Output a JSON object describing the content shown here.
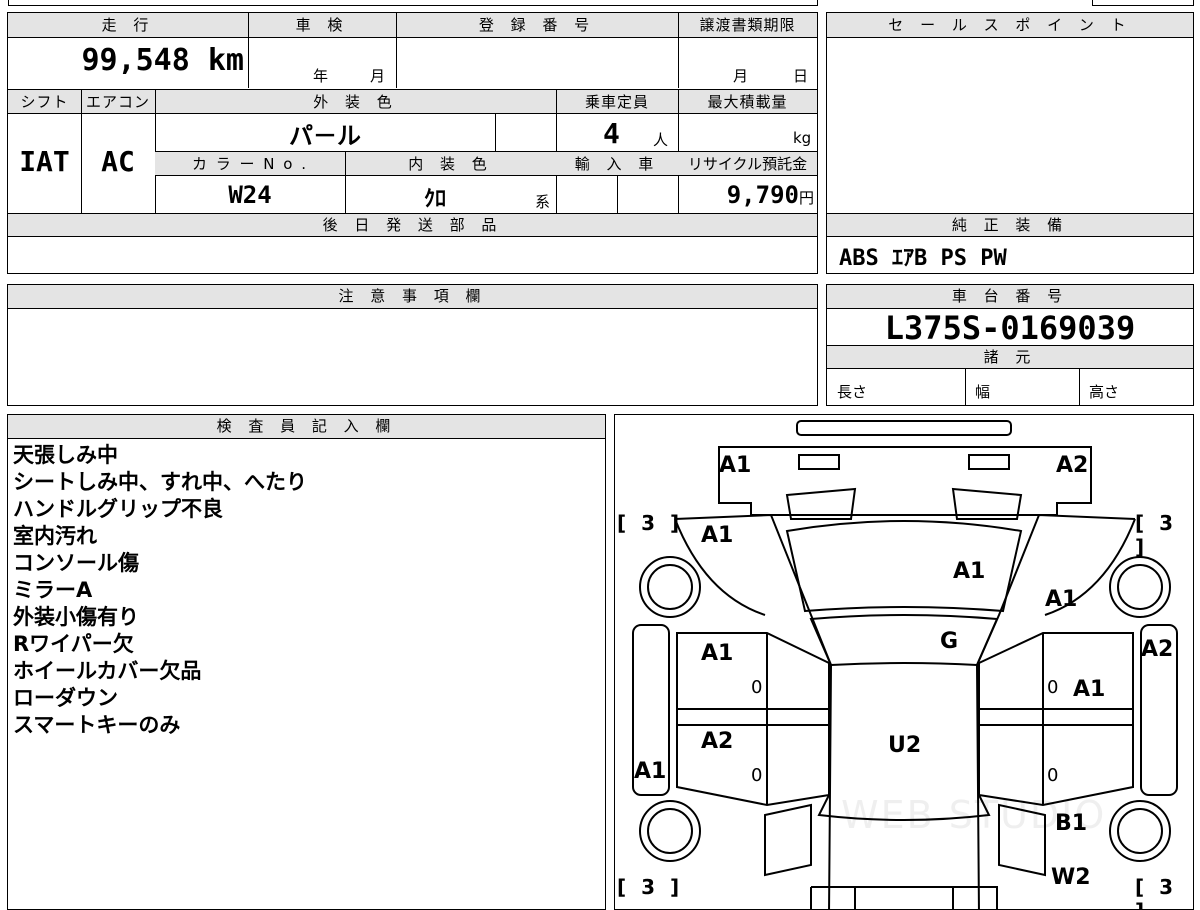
{
  "top": {
    "mileage_label": "走 行",
    "mileage_value": "99,548",
    "mileage_unit": "km",
    "inspection_label": "車 検",
    "inspection_year": "年",
    "inspection_month": "月",
    "registration_label": "登 録 番 号",
    "transfer_label": "譲渡書類期限",
    "transfer_month": "月",
    "transfer_day": "日"
  },
  "specs": {
    "shift_label": "シフト",
    "shift_value": "IAT",
    "ac_label": "エアコン",
    "ac_value": "AC",
    "exterior_label": "外 装 色",
    "exterior_value": "パ－ル",
    "capacity_label": "乗車定員",
    "capacity_value": "4",
    "capacity_unit": "人",
    "max_load_label": "最大積載量",
    "max_load_unit": "kg",
    "color_no_label": "カ ラ ー N o .",
    "color_no_value": "W24",
    "interior_label": "内 装 色",
    "interior_value": "ｸﾛ",
    "interior_suffix": "系",
    "import_label": "輸 入 車",
    "recycle_label": "リサイクル預託金",
    "recycle_value": "9,790",
    "recycle_unit": "円"
  },
  "sales_point": {
    "label": "セ ー ル ス ポ イ ン ト"
  },
  "later_parts": {
    "label": "後 日 発 送 部 品"
  },
  "equipment": {
    "label": "純 正 装 備",
    "value": "ABS ｴｱB PS PW"
  },
  "notes": {
    "label": "注 意 事 項 欄"
  },
  "chassis": {
    "label": "車 台 番 号",
    "value": "L375S-0169039"
  },
  "dimensions": {
    "label": "諸 元",
    "length_label": "長さ",
    "width_label": "幅",
    "height_label": "高さ"
  },
  "inspector": {
    "label": "検 査 員 記 入 欄",
    "lines": [
      "天張しみ中",
      "シートしみ中、すれ中、へたり",
      "ハンドルグリップ不良",
      "室内汚れ",
      "コンソール傷",
      "ミラーA",
      "外装小傷有り",
      "Rワイパー欠",
      "ホイールカバー欠品",
      "ローダウン",
      "スマートキーのみ"
    ]
  },
  "diagram": {
    "tire_marks": {
      "front_left": "[ 3 ]",
      "front_right": "[ 3 ]",
      "rear_left": "[ 3 ]",
      "rear_right": "[ 3 ]"
    },
    "marks": {
      "front_left_corner": "A1",
      "front_right_corner": "A2",
      "hood_left": "A1",
      "hood": "A1",
      "fender_right": "A1",
      "windshield": "G",
      "front_door_left": "A1",
      "front_door_right": "A1",
      "right_panel": "A2",
      "rear_door_left": "A2",
      "rear_left_panel": "A1",
      "roof": "U2",
      "rear_right_lower": "B1",
      "rear_right_bumper": "W2"
    },
    "zero_marks": [
      "0",
      "0",
      "0",
      "0"
    ],
    "watermark": "WEB STUDIO"
  }
}
